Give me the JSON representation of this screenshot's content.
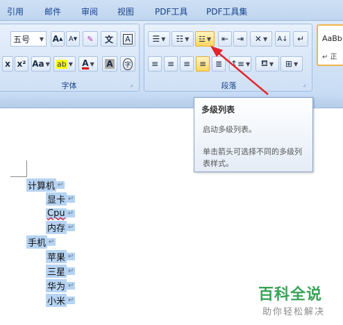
{
  "tabs": [
    "引用",
    "邮件",
    "审阅",
    "视图",
    "PDF工具",
    "PDF工具集"
  ],
  "font_group": {
    "label": "字体",
    "font_size": "五号",
    "buttons": {
      "grow": "A",
      "shrink": "A",
      "phonetic": "文",
      "char_border": "A",
      "subscript": "x",
      "superscript": "x²",
      "change_case": "Aa",
      "highlight": "ab",
      "font_color": "A",
      "char_shading": "A",
      "enclose": "字"
    }
  },
  "paragraph_group": {
    "label": "段落"
  },
  "styles_gallery": {
    "preview": "AaBb",
    "name": "↵ 正"
  },
  "tooltip": {
    "title": "多级列表",
    "description": "启动多级列表。",
    "hint": "单击箭头可选择不同的多级列表样式。"
  },
  "document": {
    "lines": [
      {
        "text": "计算机",
        "level": 0
      },
      {
        "text": "显卡",
        "level": 1
      },
      {
        "text": "Cpu",
        "level": 1
      },
      {
        "text": "内存",
        "level": 1
      },
      {
        "text": "手机",
        "level": 0
      },
      {
        "text": "苹果",
        "level": 1
      },
      {
        "text": "三星",
        "level": 1
      },
      {
        "text": "华为",
        "level": 1
      },
      {
        "text": "小米",
        "level": 1
      }
    ]
  },
  "paragraph_mark": "↵",
  "watermark": {
    "title": "百科全说",
    "subtitle": "助你轻松解决"
  },
  "colors": {
    "accent_highlight": "#b6d3f2",
    "arrow": "#e5242b",
    "watermark_green": "#39a357",
    "active_button": "#ffd660"
  }
}
